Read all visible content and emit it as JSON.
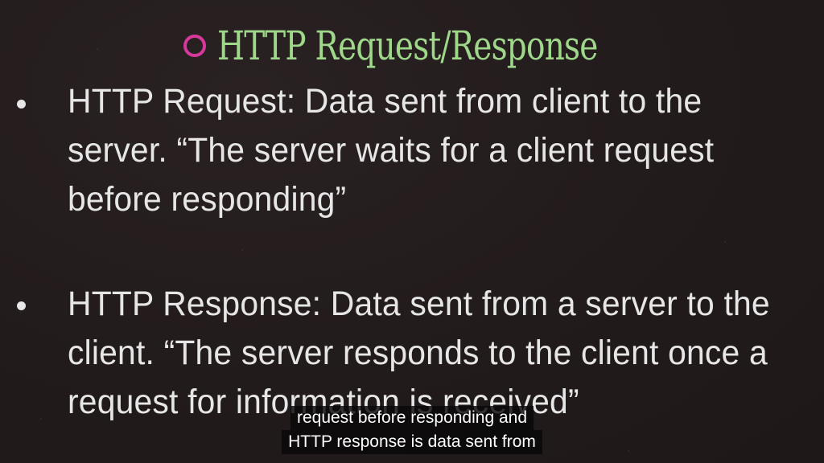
{
  "slide": {
    "title": "HTTP Request/Response",
    "bullets": [
      {
        "text": "HTTP Request: Data sent from client to the server. “The server waits for a client request before responding”"
      },
      {
        "text": "HTTP Response: Data sent from a server to the client. “The server responds to the client once a request for information is received”"
      }
    ]
  },
  "captions": {
    "lines": [
      "request before responding and",
      "HTTP response is data sent from"
    ]
  },
  "colors": {
    "background": "#221b1b",
    "title": "#9fd88a",
    "circle": "#d6389b",
    "body_text": "#e6e6e6"
  }
}
